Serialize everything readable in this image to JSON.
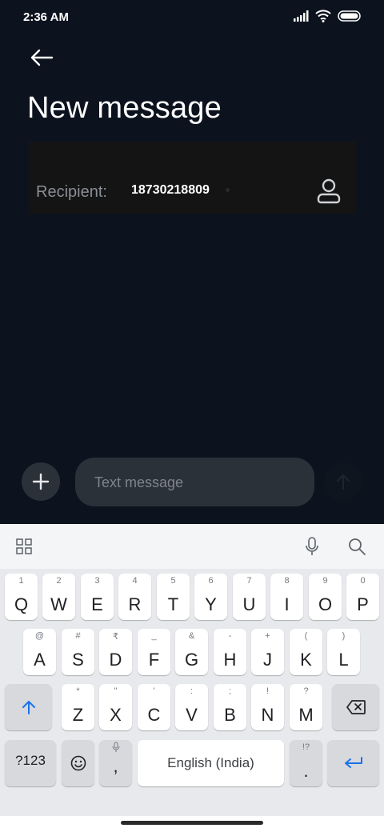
{
  "status_bar": {
    "time": "2:36 AM"
  },
  "header": {
    "title": "New message"
  },
  "recipient": {
    "label": "Recipient:",
    "value": "18730218809"
  },
  "composer": {
    "placeholder": "Text message"
  },
  "keyboard": {
    "row1": [
      {
        "hint": "1",
        "key": "Q"
      },
      {
        "hint": "2",
        "key": "W"
      },
      {
        "hint": "3",
        "key": "E"
      },
      {
        "hint": "4",
        "key": "R"
      },
      {
        "hint": "5",
        "key": "T"
      },
      {
        "hint": "6",
        "key": "Y"
      },
      {
        "hint": "7",
        "key": "U"
      },
      {
        "hint": "8",
        "key": "I"
      },
      {
        "hint": "9",
        "key": "O"
      },
      {
        "hint": "0",
        "key": "P"
      }
    ],
    "row2": [
      {
        "hint": "@",
        "key": "A"
      },
      {
        "hint": "#",
        "key": "S"
      },
      {
        "hint": "₹",
        "key": "D"
      },
      {
        "hint": "_",
        "key": "F"
      },
      {
        "hint": "&",
        "key": "G"
      },
      {
        "hint": "-",
        "key": "H"
      },
      {
        "hint": "+",
        "key": "J"
      },
      {
        "hint": "(",
        "key": "K"
      },
      {
        "hint": ")",
        "key": "L"
      }
    ],
    "row3": [
      {
        "hint": "*",
        "key": "Z"
      },
      {
        "hint": "\"",
        "key": "X"
      },
      {
        "hint": "'",
        "key": "C"
      },
      {
        "hint": ":",
        "key": "V"
      },
      {
        "hint": ";",
        "key": "B"
      },
      {
        "hint": "!",
        "key": "N"
      },
      {
        "hint": "?",
        "key": "M"
      }
    ],
    "symbols_label": "?123",
    "comma": ",",
    "space_label": "English (India)",
    "period_hint": "!?",
    "period": "."
  },
  "colors": {
    "accent": "#1a73e8",
    "background": "#0d131e",
    "keyboard_bg": "#e8e9ec"
  }
}
